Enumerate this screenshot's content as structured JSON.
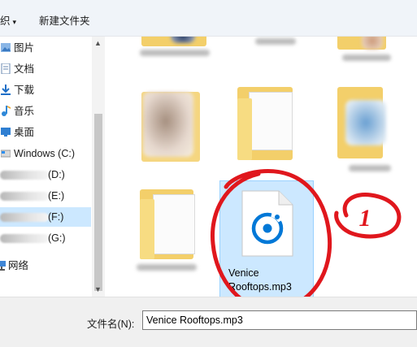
{
  "toolbar": {
    "organize_label": "织",
    "organize_caret": "▾",
    "new_folder_label": "新建文件夹"
  },
  "nav": {
    "items": [
      {
        "label": "图片",
        "icon": "pictures-icon"
      },
      {
        "label": "文档",
        "icon": "documents-icon"
      },
      {
        "label": "下载",
        "icon": "downloads-icon"
      },
      {
        "label": "音乐",
        "icon": "music-icon"
      },
      {
        "label": "桌面",
        "icon": "desktop-icon"
      },
      {
        "label": "Windows (C:)",
        "icon": "windows-drive-icon"
      },
      {
        "label": "(D:)",
        "icon": "drive-icon"
      },
      {
        "label": "(E:)",
        "icon": "drive-icon"
      },
      {
        "label": "(F:)",
        "icon": "drive-icon",
        "selected": true
      },
      {
        "label": "(G:)",
        "icon": "drive-icon"
      },
      {
        "label": "网络",
        "icon": "network-icon"
      }
    ]
  },
  "selected_file": {
    "name_line1": "Venice",
    "name_line2": "Rooftops.mp3",
    "icon": "groove-music-file-icon"
  },
  "annotation": {
    "label": "1",
    "color": "#e0171d"
  },
  "filename": {
    "label": "文件名(N):",
    "value": "Venice Rooftops.mp3"
  },
  "colors": {
    "selection": "#cce8ff",
    "accent_blue": "#0078d7",
    "folder_yellow": "#f7d56e"
  }
}
